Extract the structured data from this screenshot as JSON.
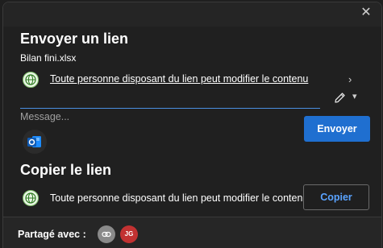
{
  "send": {
    "title": "Envoyer un lien",
    "filename": "Bilan fini.xlsx",
    "permission": "Toute personne disposant du lien peut modifier le contenu",
    "message_placeholder": "Message...",
    "send_label": "Envoyer"
  },
  "copy": {
    "title": "Copier le lien",
    "permission": "Toute personne disposant du lien peut modifier le contenu",
    "copy_label": "Copier"
  },
  "footer": {
    "shared_label": "Partagé avec :",
    "avatars": [
      {
        "name": "link-avatar",
        "initials": ""
      },
      {
        "name": "user-avatar-jg",
        "initials": "JG"
      }
    ]
  },
  "colors": {
    "primary": "#1f6fd0",
    "accent_link": "#5aa3ff",
    "avatar_jg": "#c23232"
  }
}
